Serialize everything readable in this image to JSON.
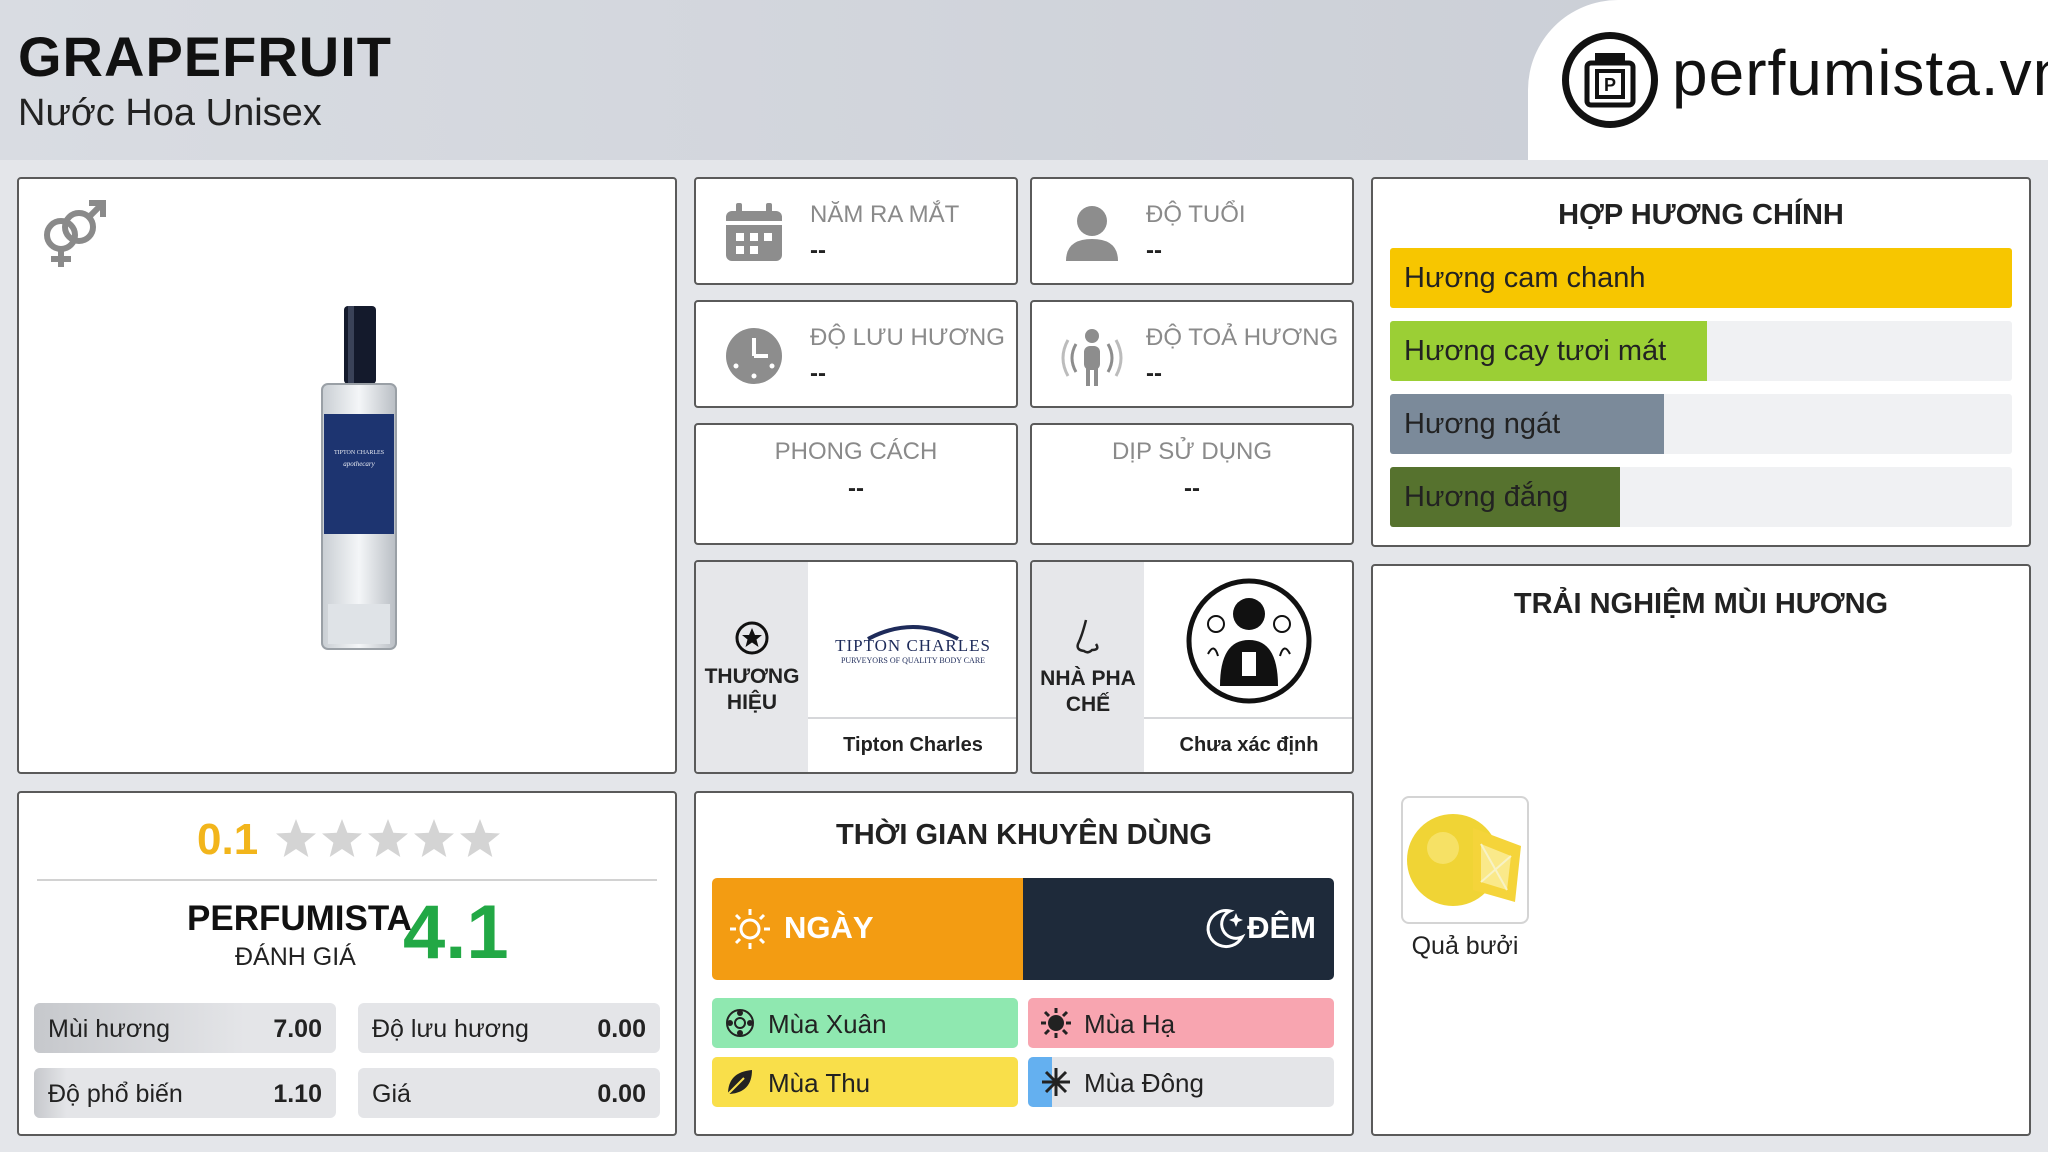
{
  "header": {
    "title": "GRAPEFRUIT",
    "subtitle": "Nước Hoa Unisex",
    "logo_text": "perfumista.vn"
  },
  "info": {
    "launch_year": {
      "label": "NĂM RA MẮT",
      "value": "--"
    },
    "age": {
      "label": "ĐỘ TUỔI",
      "value": "--"
    },
    "longevity": {
      "label": "ĐỘ LƯU HƯƠNG",
      "value": "--"
    },
    "sillage": {
      "label": "ĐỘ TOẢ HƯƠNG",
      "value": "--"
    },
    "style": {
      "label": "PHONG CÁCH",
      "value": "--"
    },
    "occasion": {
      "label": "DỊP SỬ DỤNG",
      "value": "--"
    }
  },
  "brand": {
    "label_line1": "THƯƠNG",
    "label_line2": "HIỆU",
    "logo_line1": "TIPTON CHARLES",
    "logo_line2": "PURVEYORS OF QUALITY BODY CARE",
    "name": "Tipton Charles"
  },
  "perfumer": {
    "label_line1": "NHÀ PHA",
    "label_line2": "CHẾ",
    "name": "Chưa xác định"
  },
  "accords": {
    "title": "HỢP HƯƠNG CHÍNH",
    "items": [
      {
        "label": "Hương cam chanh",
        "percent": 100,
        "color": "#f7c600"
      },
      {
        "label": "Hương cay tươi mát",
        "percent": 51,
        "color": "#9bcf35"
      },
      {
        "label": "Hương ngát",
        "percent": 44,
        "color": "#7b8a9a"
      },
      {
        "label": "Hương đắng",
        "percent": 37,
        "color": "#56722e"
      }
    ]
  },
  "experience": {
    "title": "TRẢI NGHIỆM MÙI HƯƠNG",
    "notes": [
      {
        "label": "Quả bưởi",
        "icon": "grapefruit-icon"
      }
    ]
  },
  "rating": {
    "user_score": "0.1",
    "user_stars_fraction": 0.02,
    "perfumista_label": "PERFUMISTA",
    "perfumista_sub": "ĐÁNH GIÁ",
    "perfumista_score": "4.1",
    "stats": [
      {
        "label": "Mùi hương",
        "value": "7.00",
        "fraction": 0.7
      },
      {
        "label": "Độ lưu hương",
        "value": "0.00",
        "fraction": 0
      },
      {
        "label": "Độ phổ biến",
        "value": "1.10",
        "fraction": 0.11
      },
      {
        "label": "Giá",
        "value": "0.00",
        "fraction": 0
      }
    ]
  },
  "usage": {
    "title": "THỜI GIAN KHUYÊN DÙNG",
    "day_label": "NGÀY",
    "night_label": "ĐÊM",
    "day_fraction": 0.5,
    "seasons": [
      {
        "label": "Mùa Xuân",
        "fraction": 1,
        "color": "#8fe8b0",
        "icon": "flower-icon"
      },
      {
        "label": "Mùa Hạ",
        "fraction": 1,
        "color": "#f8a5b0",
        "icon": "sun-icon"
      },
      {
        "label": "Mùa Thu",
        "fraction": 1,
        "color": "#f9df4a",
        "icon": "leaf-icon"
      },
      {
        "label": "Mùa Đông",
        "fraction": 0.08,
        "color": "#64b0f0",
        "icon": "snowflake-icon"
      }
    ]
  },
  "colors": {
    "day": "#f39c12",
    "night": "#1e2a3a",
    "user_score": "#f2b51b",
    "perfumista_score": "#22a845"
  }
}
